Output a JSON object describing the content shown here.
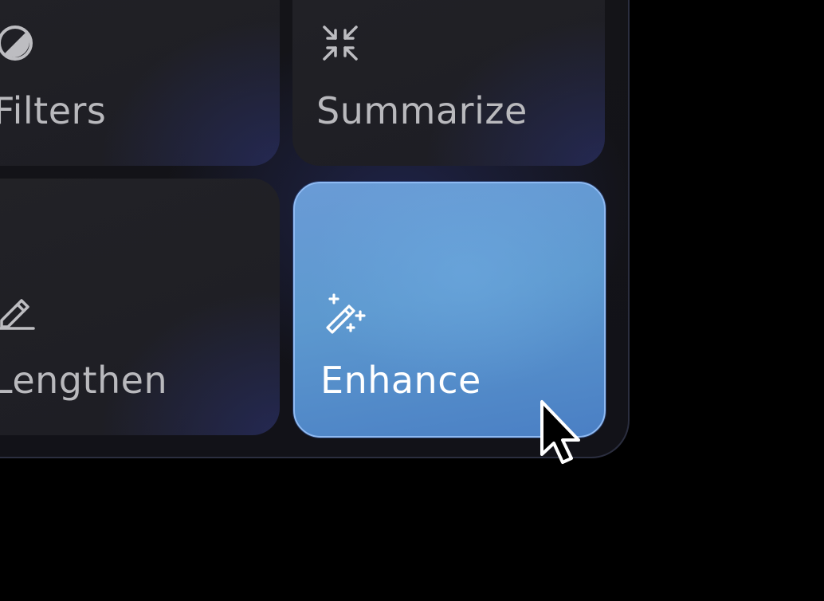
{
  "tiles": [
    {
      "label": "Filters",
      "icon": "contrast-icon",
      "state": "default"
    },
    {
      "label": "Summarize",
      "icon": "collapse-arrows-icon",
      "state": "default"
    },
    {
      "label": "Lengthen",
      "icon": "pencil-icon",
      "state": "default"
    },
    {
      "label": "Enhance",
      "icon": "magic-wand-icon",
      "state": "hovered"
    }
  ],
  "colors": {
    "background": "#000000",
    "tile_dark": "#222226",
    "tile_active": "#5d99cf",
    "tile_active_border": "#8fbaf2",
    "label_muted": "#b9b9bd",
    "label_active": "#ffffff"
  }
}
